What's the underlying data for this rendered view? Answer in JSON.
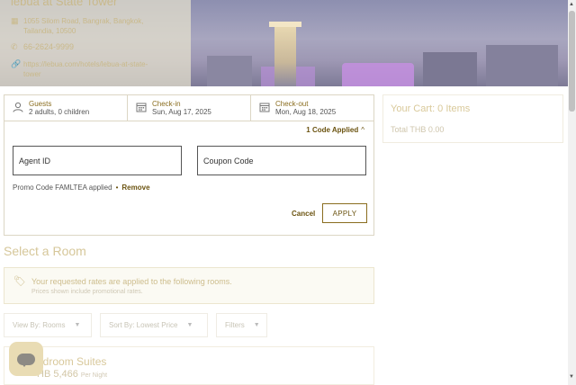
{
  "hotel": {
    "name": "lebua at State Tower",
    "address_line1": "1055 Silom Road, Bangrak, Bangkok,",
    "address_line2": "Tailandia, 10500",
    "phone": "66-2624-9999",
    "website_line1": "https://lebua.com/hotels/lebua-at-state-",
    "website_line2": "tower"
  },
  "summary": {
    "guests_label": "Guests",
    "guests_value": "2 adults, 0 children",
    "checkin_label": "Check-in",
    "checkin_value": "Sun, Aug 17, 2025",
    "checkout_label": "Check-out",
    "checkout_value": "Mon, Aug 18, 2025"
  },
  "promo": {
    "applied_toggle": "1 Code Applied",
    "agent_placeholder": "Agent ID",
    "coupon_placeholder": "Coupon Code",
    "applied_text": "Promo Code FAMLTEA applied",
    "remove_label": "Remove",
    "cancel_label": "Cancel",
    "apply_label": "APPLY"
  },
  "cart": {
    "title": "Your Cart: 0 Items",
    "total": "Total THB 0.00"
  },
  "rooms": {
    "section_title": "Select a Room",
    "notice_line1": "Your requested rates are applied to the following rooms.",
    "notice_line2": "Prices shown include promotional rates.",
    "filters": [
      {
        "label": "View By: Rooms"
      },
      {
        "label": "Sort By: Lowest Price"
      },
      {
        "label": "Filters"
      }
    ],
    "first_room_name": "edroom Suites",
    "first_room_price": "HB 5,466",
    "first_room_per": "Per Night"
  },
  "icons": {
    "guests": "user-icon",
    "checkin": "calendar-icon",
    "checkout": "calendar-icon",
    "notice": "tag-icon",
    "chat": "chat-icon"
  },
  "colors": {
    "accent": "#8a6d1f",
    "border": "#dcd6c4"
  }
}
